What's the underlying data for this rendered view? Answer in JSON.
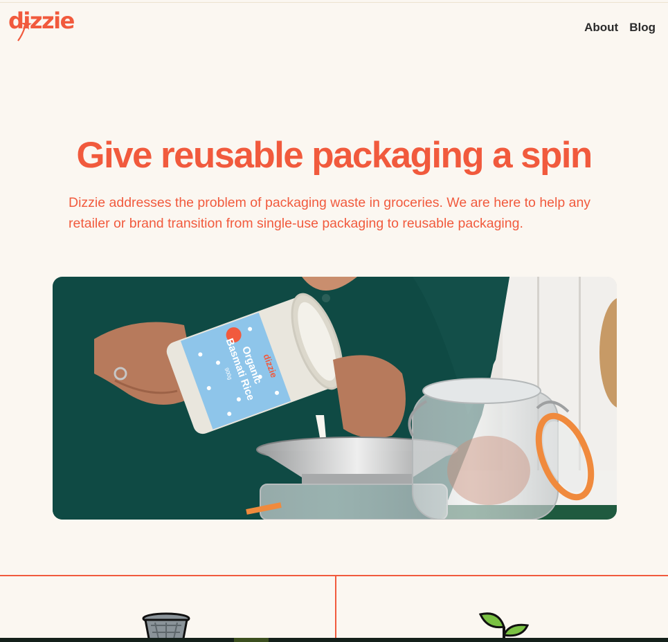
{
  "header": {
    "logo_text": "dizzie",
    "nav": [
      {
        "label": "About"
      },
      {
        "label": "Blog"
      }
    ]
  },
  "hero": {
    "title": "Give reusable packaging a spin",
    "subtitle": "Dizzie addresses the problem of packaging waste in groceries. We are here to help any retailer or brand transition from single-use packaging to reusable packaging."
  },
  "photo": {
    "product_brand": "dizzie",
    "product_name_line1": "Organic",
    "product_name_line2": "Basmati Rice",
    "product_weight": "900g"
  },
  "features": {
    "icons": [
      "trash-bin-icon",
      "sprout-icon"
    ]
  },
  "colors": {
    "brand": "#f15a3d",
    "background": "#fbf7f1",
    "text_dark": "#2b2b2b",
    "green_shirt": "#0f4a44"
  }
}
